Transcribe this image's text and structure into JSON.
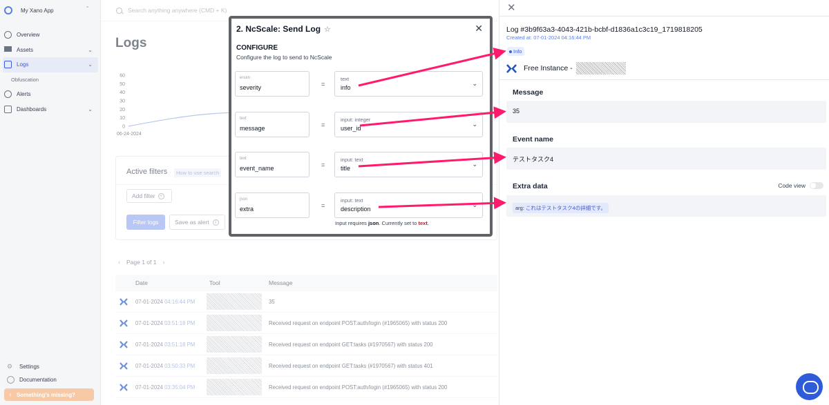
{
  "app": {
    "name": "My Xano App"
  },
  "search": {
    "placeholder": "Search anything anywhere (CMD + K)"
  },
  "sidebar": {
    "items": [
      {
        "label": "Overview",
        "icon": "overview-icon"
      },
      {
        "label": "Assets",
        "icon": "grid-icon"
      },
      {
        "label": "Logs",
        "icon": "logs-icon"
      },
      {
        "label": "Obfuscation"
      },
      {
        "label": "Alerts",
        "icon": "alert-icon"
      },
      {
        "label": "Dashboards",
        "icon": "dashboard-icon"
      }
    ],
    "bottom": [
      {
        "label": "Settings",
        "icon": "gear-icon"
      },
      {
        "label": "Documentation",
        "icon": "help-icon"
      }
    ],
    "missing_label": "Something's missing?"
  },
  "page": {
    "title": "Logs"
  },
  "chart_data": {
    "type": "line",
    "x": [
      "06-24-2024"
    ],
    "yticks": [
      0,
      10,
      20,
      30,
      40,
      50,
      60
    ],
    "ylim": [
      0,
      60
    ],
    "color": "#8fa8e8"
  },
  "filters": {
    "title": "Active filters",
    "help": "How to use search",
    "add_filter": "Add filter",
    "filter_button": "Filter logs",
    "save_alert": "Save as alert"
  },
  "pager": {
    "label": "Page 1 of 1"
  },
  "table": {
    "columns": [
      "Date",
      "Tool",
      "Message"
    ],
    "rows": [
      {
        "date": "07-01-2024",
        "time": "04:16:44 PM",
        "message": "35"
      },
      {
        "date": "07-01-2024",
        "time": "03:51:18 PM",
        "message": "Received request on endpoint POST:auth/login (#1965065) with status 200"
      },
      {
        "date": "07-01-2024",
        "time": "03:51:18 PM",
        "message": "Received request on endpoint GET:tasks (#1970567) with status 200"
      },
      {
        "date": "07-01-2024",
        "time": "03:50:33 PM",
        "message": "Received request on endpoint GET:tasks (#1970567) with status 401"
      },
      {
        "date": "07-01-2024",
        "time": "03:35:04 PM",
        "message": "Received request on endpoint POST:auth/login (#1965065) with status 200"
      }
    ]
  },
  "modal": {
    "title": "2. NcScale: Send Log",
    "config_heading": "CONFIGURE",
    "config_desc": "Configure the log to send to NcScale",
    "params": [
      {
        "type": "enum",
        "name": "severity",
        "source_type": "text",
        "source_value": "info"
      },
      {
        "type": "text",
        "name": "message",
        "source_type": "input: integer",
        "source_value": "user_id"
      },
      {
        "type": "text",
        "name": "event_name",
        "source_type": "input: text",
        "source_value": "title"
      },
      {
        "type": "json",
        "name": "extra",
        "source_type": "input: text",
        "source_value": "description"
      }
    ],
    "equals": "=",
    "requires_prefix": "Input requires",
    "requires_type": "json",
    "requires_mid": ". Currently set to",
    "requires_current": "text",
    "requires_end": "."
  },
  "detail": {
    "log_id": "Log #3b9f63a3-4043-421b-bcbf-d1836a1c3c19_1719818205",
    "created": "Created at: 07-01-2024 04:16:44 PM",
    "level": "Info",
    "instance": "Free Instance -",
    "message_label": "Message",
    "message_value": "35",
    "event_label": "Event name",
    "event_value": "テストタスク4",
    "extra_label": "Extra data",
    "code_view": "Code view",
    "extra_key": "arg:",
    "extra_value": "これはテストタスク4の詳細です。"
  },
  "colors": {
    "accent": "#3b5bdb",
    "arrow": "#ff1a6e",
    "xano": "#1f56c4"
  }
}
